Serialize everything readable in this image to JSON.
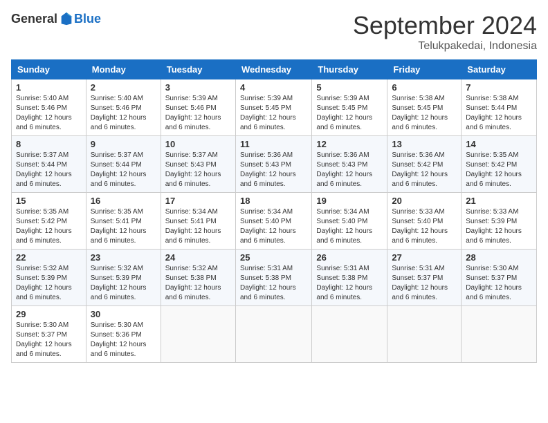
{
  "header": {
    "logo_general": "General",
    "logo_blue": "Blue",
    "month_title": "September 2024",
    "location": "Telukpakedai, Indonesia"
  },
  "days_of_week": [
    "Sunday",
    "Monday",
    "Tuesday",
    "Wednesday",
    "Thursday",
    "Friday",
    "Saturday"
  ],
  "weeks": [
    [
      {
        "day": "1",
        "sunrise": "5:40 AM",
        "sunset": "5:46 PM",
        "daylight": "12 hours and 6 minutes."
      },
      {
        "day": "2",
        "sunrise": "5:40 AM",
        "sunset": "5:46 PM",
        "daylight": "12 hours and 6 minutes."
      },
      {
        "day": "3",
        "sunrise": "5:39 AM",
        "sunset": "5:46 PM",
        "daylight": "12 hours and 6 minutes."
      },
      {
        "day": "4",
        "sunrise": "5:39 AM",
        "sunset": "5:45 PM",
        "daylight": "12 hours and 6 minutes."
      },
      {
        "day": "5",
        "sunrise": "5:39 AM",
        "sunset": "5:45 PM",
        "daylight": "12 hours and 6 minutes."
      },
      {
        "day": "6",
        "sunrise": "5:38 AM",
        "sunset": "5:45 PM",
        "daylight": "12 hours and 6 minutes."
      },
      {
        "day": "7",
        "sunrise": "5:38 AM",
        "sunset": "5:44 PM",
        "daylight": "12 hours and 6 minutes."
      }
    ],
    [
      {
        "day": "8",
        "sunrise": "5:37 AM",
        "sunset": "5:44 PM",
        "daylight": "12 hours and 6 minutes."
      },
      {
        "day": "9",
        "sunrise": "5:37 AM",
        "sunset": "5:44 PM",
        "daylight": "12 hours and 6 minutes."
      },
      {
        "day": "10",
        "sunrise": "5:37 AM",
        "sunset": "5:43 PM",
        "daylight": "12 hours and 6 minutes."
      },
      {
        "day": "11",
        "sunrise": "5:36 AM",
        "sunset": "5:43 PM",
        "daylight": "12 hours and 6 minutes."
      },
      {
        "day": "12",
        "sunrise": "5:36 AM",
        "sunset": "5:43 PM",
        "daylight": "12 hours and 6 minutes."
      },
      {
        "day": "13",
        "sunrise": "5:36 AM",
        "sunset": "5:42 PM",
        "daylight": "12 hours and 6 minutes."
      },
      {
        "day": "14",
        "sunrise": "5:35 AM",
        "sunset": "5:42 PM",
        "daylight": "12 hours and 6 minutes."
      }
    ],
    [
      {
        "day": "15",
        "sunrise": "5:35 AM",
        "sunset": "5:42 PM",
        "daylight": "12 hours and 6 minutes."
      },
      {
        "day": "16",
        "sunrise": "5:35 AM",
        "sunset": "5:41 PM",
        "daylight": "12 hours and 6 minutes."
      },
      {
        "day": "17",
        "sunrise": "5:34 AM",
        "sunset": "5:41 PM",
        "daylight": "12 hours and 6 minutes."
      },
      {
        "day": "18",
        "sunrise": "5:34 AM",
        "sunset": "5:40 PM",
        "daylight": "12 hours and 6 minutes."
      },
      {
        "day": "19",
        "sunrise": "5:34 AM",
        "sunset": "5:40 PM",
        "daylight": "12 hours and 6 minutes."
      },
      {
        "day": "20",
        "sunrise": "5:33 AM",
        "sunset": "5:40 PM",
        "daylight": "12 hours and 6 minutes."
      },
      {
        "day": "21",
        "sunrise": "5:33 AM",
        "sunset": "5:39 PM",
        "daylight": "12 hours and 6 minutes."
      }
    ],
    [
      {
        "day": "22",
        "sunrise": "5:32 AM",
        "sunset": "5:39 PM",
        "daylight": "12 hours and 6 minutes."
      },
      {
        "day": "23",
        "sunrise": "5:32 AM",
        "sunset": "5:39 PM",
        "daylight": "12 hours and 6 minutes."
      },
      {
        "day": "24",
        "sunrise": "5:32 AM",
        "sunset": "5:38 PM",
        "daylight": "12 hours and 6 minutes."
      },
      {
        "day": "25",
        "sunrise": "5:31 AM",
        "sunset": "5:38 PM",
        "daylight": "12 hours and 6 minutes."
      },
      {
        "day": "26",
        "sunrise": "5:31 AM",
        "sunset": "5:38 PM",
        "daylight": "12 hours and 6 minutes."
      },
      {
        "day": "27",
        "sunrise": "5:31 AM",
        "sunset": "5:37 PM",
        "daylight": "12 hours and 6 minutes."
      },
      {
        "day": "28",
        "sunrise": "5:30 AM",
        "sunset": "5:37 PM",
        "daylight": "12 hours and 6 minutes."
      }
    ],
    [
      {
        "day": "29",
        "sunrise": "5:30 AM",
        "sunset": "5:37 PM",
        "daylight": "12 hours and 6 minutes."
      },
      {
        "day": "30",
        "sunrise": "5:30 AM",
        "sunset": "5:36 PM",
        "daylight": "12 hours and 6 minutes."
      },
      null,
      null,
      null,
      null,
      null
    ]
  ]
}
